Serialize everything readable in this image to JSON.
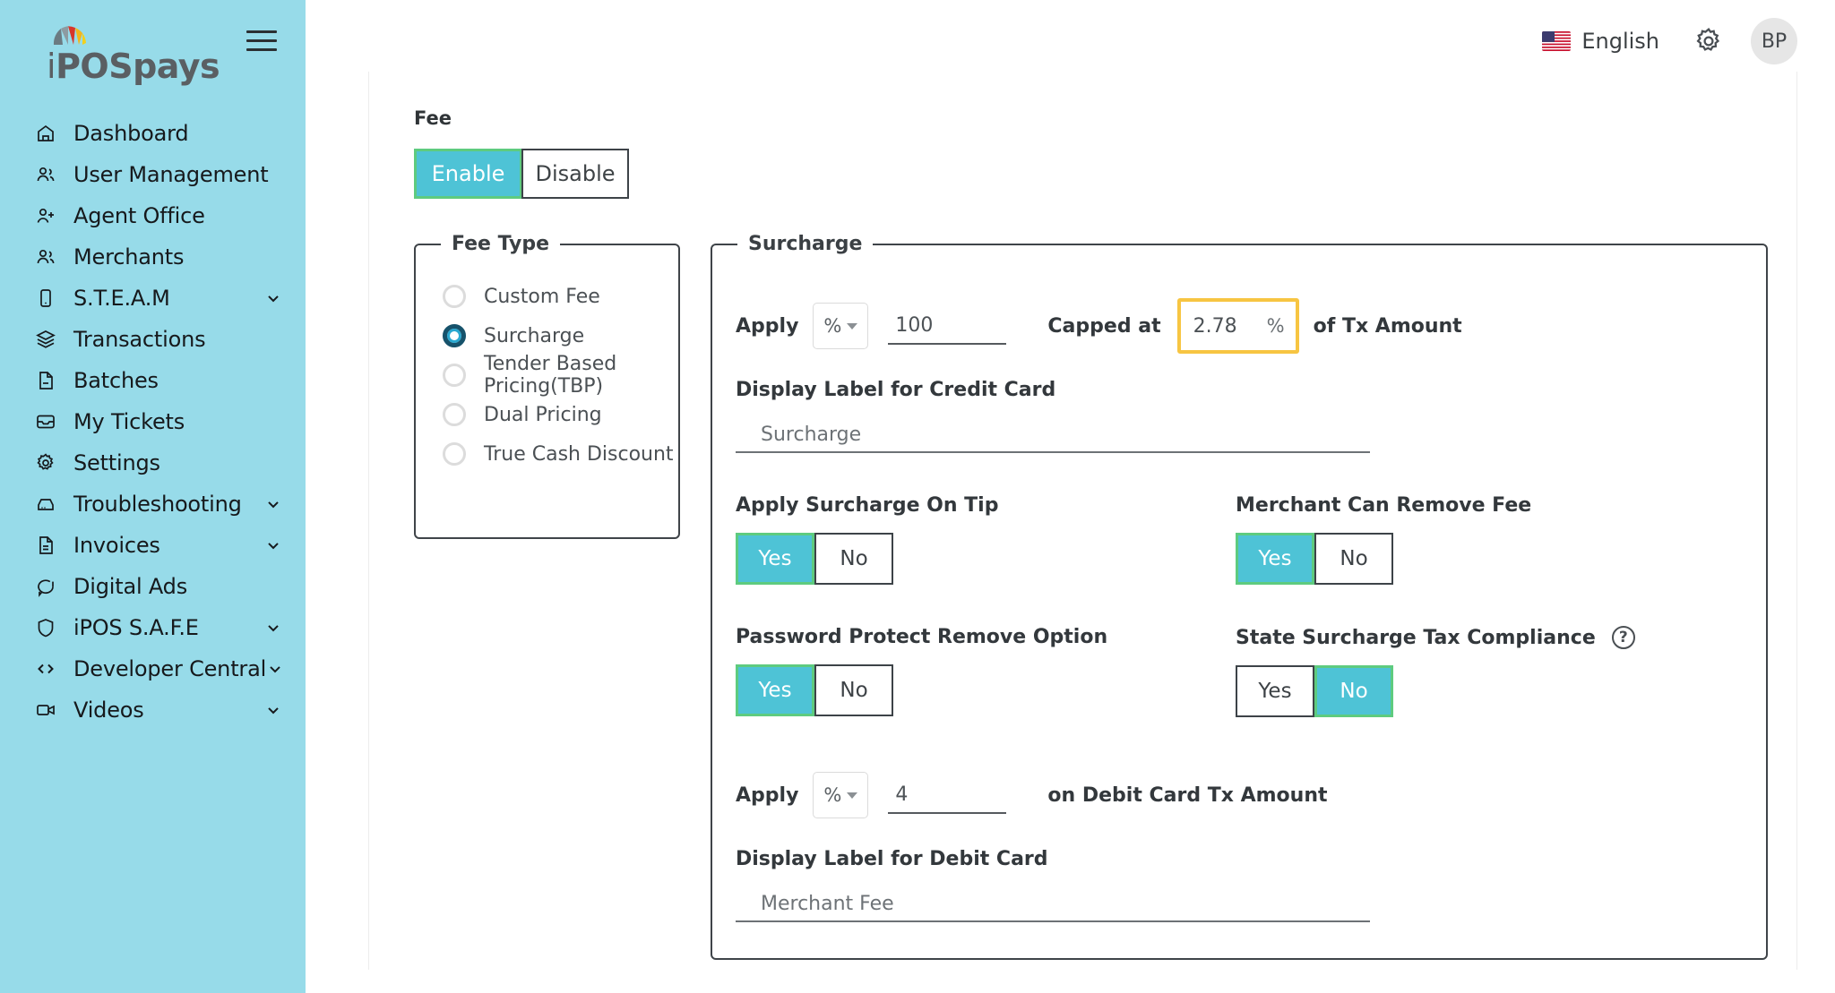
{
  "sidebar": {
    "logo": {
      "prefix": "i",
      "name": "POSpays",
      "icon": "umbrella-icon"
    },
    "menu_icon": "hamburger-icon",
    "items": [
      {
        "label": "Dashboard",
        "icon": "home-icon",
        "expandable": false
      },
      {
        "label": "User Management",
        "icon": "users-icon",
        "expandable": false
      },
      {
        "label": "Agent Office",
        "icon": "user-plus-icon",
        "expandable": false
      },
      {
        "label": "Merchants",
        "icon": "users-icon",
        "expandable": false
      },
      {
        "label": "S.T.E.A.M",
        "icon": "device-icon",
        "expandable": true
      },
      {
        "label": "Transactions",
        "icon": "layers-icon",
        "expandable": false
      },
      {
        "label": "Batches",
        "icon": "file-minus-icon",
        "expandable": false
      },
      {
        "label": "My Tickets",
        "icon": "inbox-icon",
        "expandable": false
      },
      {
        "label": "Settings",
        "icon": "gear-icon",
        "expandable": false
      },
      {
        "label": "Troubleshooting",
        "icon": "server-icon",
        "expandable": true
      },
      {
        "label": "Invoices",
        "icon": "document-icon",
        "expandable": true
      },
      {
        "label": "Digital Ads",
        "icon": "chat-icon",
        "expandable": false
      },
      {
        "label": "iPOS S.A.F.E",
        "icon": "shield-icon",
        "expandable": true
      },
      {
        "label": "Developer Central",
        "icon": "code-icon",
        "expandable": true
      },
      {
        "label": "Videos",
        "icon": "video-icon",
        "expandable": true
      }
    ]
  },
  "topbar": {
    "language": "English",
    "flag_icon": "us-flag-icon",
    "settings_icon": "gear-icon",
    "avatar_initials": "BP"
  },
  "fee": {
    "title": "Fee",
    "enable_label": "Enable",
    "disable_label": "Disable",
    "selected": "Enable"
  },
  "fee_type": {
    "legend": "Fee Type",
    "options": [
      {
        "label": "Custom Fee",
        "checked": false
      },
      {
        "label": "Surcharge",
        "checked": true
      },
      {
        "label": "Tender Based Pricing(TBP)",
        "checked": false
      },
      {
        "label": "Dual Pricing",
        "checked": false
      },
      {
        "label": "True Cash Discount",
        "checked": false
      }
    ]
  },
  "surcharge": {
    "legend": "Surcharge",
    "apply_label": "Apply",
    "unit": "%",
    "amount": "100",
    "capped_at_label": "Capped at",
    "capped_value": "2.78",
    "capped_unit": "%",
    "of_tx_amount_label": "of Tx Amount",
    "credit_label_title": "Display Label for Credit Card",
    "credit_label_value": "Surcharge",
    "toggles": [
      {
        "label": "Apply Surcharge On Tip",
        "yes": "Yes",
        "no": "No",
        "selected": "Yes",
        "help": false
      },
      {
        "label": "Merchant Can Remove Fee",
        "yes": "Yes",
        "no": "No",
        "selected": "Yes",
        "help": false
      },
      {
        "label": "Password Protect Remove Option",
        "yes": "Yes",
        "no": "No",
        "selected": "Yes",
        "help": false
      },
      {
        "label": "State Surcharge Tax Compliance",
        "yes": "Yes",
        "no": "No",
        "selected": "No",
        "help": true
      }
    ],
    "debit_apply_label": "Apply",
    "debit_unit": "%",
    "debit_amount": "4",
    "debit_suffix_label": "on Debit Card Tx Amount",
    "debit_label_title": "Display Label for Debit Card",
    "debit_label_value": "Merchant Fee"
  },
  "colors": {
    "sidebar": "#97dbe9",
    "accent_teal": "#4ec3d6",
    "accent_green": "#5ecb7f",
    "highlight_yellow": "#f7c542",
    "radio_selected": "#29a8d0"
  }
}
